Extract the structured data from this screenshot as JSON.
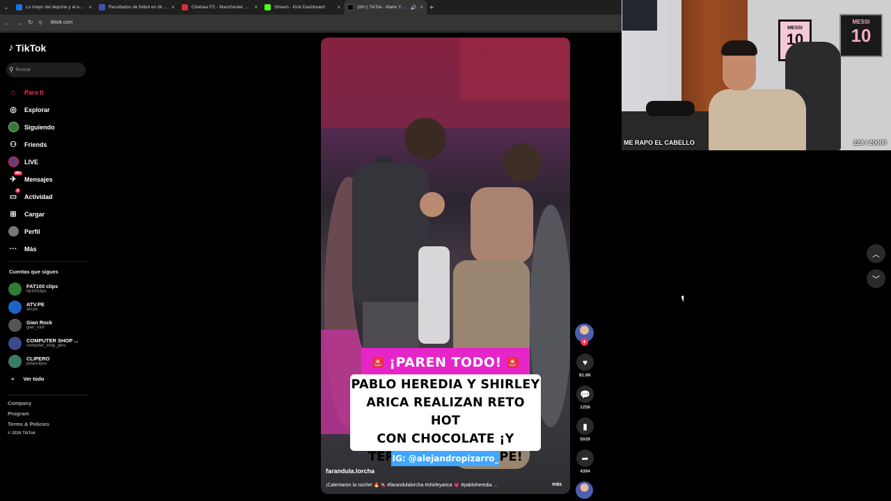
{
  "browser": {
    "tabs": [
      {
        "title": "Lo mejor del deporte y el entre",
        "color": "#1a73e8"
      },
      {
        "title": "Resultados de fútbol en directo",
        "color": "#3f51b5"
      },
      {
        "title": "Chelsea FC - Manchester City C",
        "color": "#d32f2f"
      },
      {
        "title": "Stream - Kick Dashboard",
        "color": "#53fc18"
      },
      {
        "title": "(99+) TikTok - Make Your Da",
        "color": "#000000"
      }
    ],
    "url": "tiktok.com"
  },
  "sidebar": {
    "logo": "TikTok",
    "search_placeholder": "Buscar",
    "nav": [
      {
        "label": "Para ti",
        "icon": "home-icon"
      },
      {
        "label": "Explorar",
        "icon": "compass-icon"
      },
      {
        "label": "Siguiendo",
        "icon": "following-avatar-icon"
      },
      {
        "label": "Friends",
        "icon": "friends-icon"
      },
      {
        "label": "LIVE",
        "icon": "live-icon"
      },
      {
        "label": "Mensajes",
        "icon": "messages-icon",
        "badge": "99+"
      },
      {
        "label": "Actividad",
        "icon": "activity-icon",
        "badge": "3"
      },
      {
        "label": "Cargar",
        "icon": "upload-icon"
      },
      {
        "label": "Perfil",
        "icon": "profile-icon"
      },
      {
        "label": "Más",
        "icon": "more-icon"
      }
    ],
    "following_title": "Cuentas que sigues",
    "following": [
      {
        "name": "FAT100 clips",
        "handle": "fat100clips",
        "color": "#2f7d32"
      },
      {
        "name": "ATV.PE",
        "handle": "atv.pe",
        "color": "#1e63c9"
      },
      {
        "name": "Gian Rock",
        "handle": "gian_rock",
        "color": "#555555"
      },
      {
        "name": "COMPUTER SHOP ...",
        "handle": "computer_shop_peru",
        "color": "#3c4b8a"
      },
      {
        "name": "CLIPERO",
        "handle": "pelaoclipsx",
        "color": "#3a7a6a"
      }
    ],
    "see_all": "Ver todo",
    "footer": [
      "Company",
      "Program",
      "Terms & Policies"
    ],
    "copyright": "© 2026 TikTok"
  },
  "video": {
    "banner_top": "¡PAREN TODO!",
    "banner_lines": [
      "PABLO HEREDIA Y SHIRLEY",
      "ARICA REALIZAN RETO HOT",
      "CON CHOCOLATE ¡Y",
      "TERMINAN EN CHAPE!"
    ],
    "banner_ig": "IG: @alejandropizarro_",
    "username": "farandula.lorcha",
    "description": "¡Calentaron la noche! 🔥🍫 #farandulalorcha #shirleyarica 💗 #pabloheredia ...",
    "more": "más"
  },
  "actions": {
    "likes": "81.8K",
    "comments": "1258",
    "saves": "5028",
    "shares": "4394"
  },
  "webcam": {
    "label_left": "ME RAPO EL CABELLO",
    "label_right": "228 / 20000",
    "frame1_top": "MESSI",
    "frame1_num": "10",
    "frame2_top": "MESSI",
    "frame2_num": "10"
  }
}
